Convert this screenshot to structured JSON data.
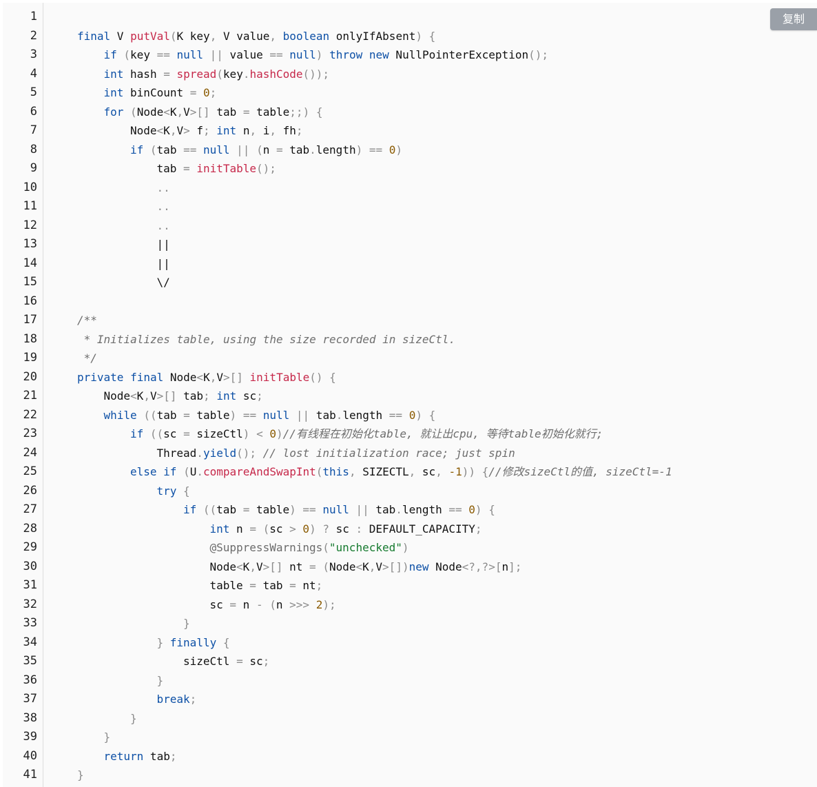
{
  "copy_button": {
    "label": "复制"
  },
  "colors": {
    "keyword": "#0d50a6",
    "function": "#c6284a",
    "number": "#8a5a00",
    "string": "#167a2f",
    "comment": "#6e6e6e",
    "operator": "#8b8b8b",
    "plain": "#111111"
  },
  "code_lines": [
    {
      "n": "1",
      "indent": 0,
      "tokens": []
    },
    {
      "n": "2",
      "indent": 1,
      "tokens": [
        [
          "kw",
          "final"
        ],
        [
          "pl",
          " V "
        ],
        [
          "fn",
          "putVal"
        ],
        [
          "op",
          "("
        ],
        [
          "pl",
          "K key"
        ],
        [
          "op",
          ","
        ],
        [
          "pl",
          " V value"
        ],
        [
          "op",
          ","
        ],
        [
          "pl",
          " "
        ],
        [
          "kw",
          "boolean"
        ],
        [
          "pl",
          " onlyIfAbsent"
        ],
        [
          "op",
          ")"
        ],
        [
          "pl",
          " "
        ],
        [
          "op",
          "{"
        ]
      ]
    },
    {
      "n": "3",
      "indent": 2,
      "tokens": [
        [
          "kw",
          "if"
        ],
        [
          "pl",
          " "
        ],
        [
          "op",
          "("
        ],
        [
          "pl",
          "key "
        ],
        [
          "op",
          "=="
        ],
        [
          "pl",
          " "
        ],
        [
          "kw",
          "null"
        ],
        [
          "pl",
          " "
        ],
        [
          "op",
          "||"
        ],
        [
          "pl",
          " value "
        ],
        [
          "op",
          "=="
        ],
        [
          "pl",
          " "
        ],
        [
          "kw",
          "null"
        ],
        [
          "op",
          ")"
        ],
        [
          "pl",
          " "
        ],
        [
          "kw",
          "throw"
        ],
        [
          "pl",
          " "
        ],
        [
          "kw",
          "new"
        ],
        [
          "pl",
          " NullPointerException"
        ],
        [
          "op",
          "();"
        ]
      ]
    },
    {
      "n": "4",
      "indent": 2,
      "tokens": [
        [
          "kw",
          "int"
        ],
        [
          "pl",
          " hash "
        ],
        [
          "op",
          "="
        ],
        [
          "pl",
          " "
        ],
        [
          "fn",
          "spread"
        ],
        [
          "op",
          "("
        ],
        [
          "pl",
          "key"
        ],
        [
          "op",
          "."
        ],
        [
          "fn",
          "hashCode"
        ],
        [
          "op",
          "());"
        ]
      ]
    },
    {
      "n": "5",
      "indent": 2,
      "tokens": [
        [
          "kw",
          "int"
        ],
        [
          "pl",
          " binCount "
        ],
        [
          "op",
          "="
        ],
        [
          "pl",
          " "
        ],
        [
          "num",
          "0"
        ],
        [
          "op",
          ";"
        ]
      ]
    },
    {
      "n": "6",
      "indent": 2,
      "tokens": [
        [
          "kw",
          "for"
        ],
        [
          "pl",
          " "
        ],
        [
          "op",
          "("
        ],
        [
          "pl",
          "Node"
        ],
        [
          "op",
          "<"
        ],
        [
          "pl",
          "K"
        ],
        [
          "op",
          ","
        ],
        [
          "pl",
          "V"
        ],
        [
          "op",
          ">[]"
        ],
        [
          "pl",
          " tab "
        ],
        [
          "op",
          "="
        ],
        [
          "pl",
          " table"
        ],
        [
          "op",
          ";;)"
        ],
        [
          "pl",
          " "
        ],
        [
          "op",
          "{"
        ]
      ]
    },
    {
      "n": "7",
      "indent": 3,
      "tokens": [
        [
          "pl",
          "Node"
        ],
        [
          "op",
          "<"
        ],
        [
          "pl",
          "K"
        ],
        [
          "op",
          ","
        ],
        [
          "pl",
          "V"
        ],
        [
          "op",
          ">"
        ],
        [
          "pl",
          " f"
        ],
        [
          "op",
          ";"
        ],
        [
          "pl",
          " "
        ],
        [
          "kw",
          "int"
        ],
        [
          "pl",
          " n"
        ],
        [
          "op",
          ","
        ],
        [
          "pl",
          " i"
        ],
        [
          "op",
          ","
        ],
        [
          "pl",
          " fh"
        ],
        [
          "op",
          ";"
        ]
      ]
    },
    {
      "n": "8",
      "indent": 3,
      "tokens": [
        [
          "kw",
          "if"
        ],
        [
          "pl",
          " "
        ],
        [
          "op",
          "("
        ],
        [
          "pl",
          "tab "
        ],
        [
          "op",
          "=="
        ],
        [
          "pl",
          " "
        ],
        [
          "kw",
          "null"
        ],
        [
          "pl",
          " "
        ],
        [
          "op",
          "||"
        ],
        [
          "pl",
          " "
        ],
        [
          "op",
          "("
        ],
        [
          "pl",
          "n "
        ],
        [
          "op",
          "="
        ],
        [
          "pl",
          " tab"
        ],
        [
          "op",
          "."
        ],
        [
          "pl",
          "length"
        ],
        [
          "op",
          ")"
        ],
        [
          "pl",
          " "
        ],
        [
          "op",
          "=="
        ],
        [
          "pl",
          " "
        ],
        [
          "num",
          "0"
        ],
        [
          "op",
          ")"
        ]
      ]
    },
    {
      "n": "9",
      "indent": 4,
      "tokens": [
        [
          "pl",
          "tab "
        ],
        [
          "op",
          "="
        ],
        [
          "pl",
          " "
        ],
        [
          "fn",
          "initTable"
        ],
        [
          "op",
          "();"
        ]
      ]
    },
    {
      "n": "10",
      "indent": 4,
      "tokens": [
        [
          "op",
          ".."
        ]
      ]
    },
    {
      "n": "11",
      "indent": 4,
      "tokens": [
        [
          "op",
          ".."
        ]
      ]
    },
    {
      "n": "12",
      "indent": 4,
      "tokens": [
        [
          "op",
          ".."
        ]
      ]
    },
    {
      "n": "13",
      "indent": 4,
      "tokens": [
        [
          "pl",
          "||"
        ]
      ]
    },
    {
      "n": "14",
      "indent": 4,
      "tokens": [
        [
          "pl",
          "||"
        ]
      ]
    },
    {
      "n": "15",
      "indent": 4,
      "tokens": [
        [
          "pl",
          "\\/"
        ]
      ]
    },
    {
      "n": "16",
      "indent": 0,
      "tokens": []
    },
    {
      "n": "17",
      "indent": 1,
      "tokens": [
        [
          "cm",
          "/**"
        ]
      ]
    },
    {
      "n": "18",
      "indent": 1,
      "tokens": [
        [
          "cm",
          " * Initializes table, using the size recorded in sizeCtl."
        ]
      ]
    },
    {
      "n": "19",
      "indent": 1,
      "tokens": [
        [
          "cm",
          " */"
        ]
      ]
    },
    {
      "n": "20",
      "indent": 1,
      "tokens": [
        [
          "kw",
          "private"
        ],
        [
          "pl",
          " "
        ],
        [
          "kw",
          "final"
        ],
        [
          "pl",
          " Node"
        ],
        [
          "op",
          "<"
        ],
        [
          "pl",
          "K"
        ],
        [
          "op",
          ","
        ],
        [
          "pl",
          "V"
        ],
        [
          "op",
          ">[]"
        ],
        [
          "pl",
          " "
        ],
        [
          "fn",
          "initTable"
        ],
        [
          "op",
          "()"
        ],
        [
          "pl",
          " "
        ],
        [
          "op",
          "{"
        ]
      ]
    },
    {
      "n": "21",
      "indent": 2,
      "tokens": [
        [
          "pl",
          "Node"
        ],
        [
          "op",
          "<"
        ],
        [
          "pl",
          "K"
        ],
        [
          "op",
          ","
        ],
        [
          "pl",
          "V"
        ],
        [
          "op",
          ">[]"
        ],
        [
          "pl",
          " tab"
        ],
        [
          "op",
          ";"
        ],
        [
          "pl",
          " "
        ],
        [
          "kw",
          "int"
        ],
        [
          "pl",
          " sc"
        ],
        [
          "op",
          ";"
        ]
      ]
    },
    {
      "n": "22",
      "indent": 2,
      "tokens": [
        [
          "kw",
          "while"
        ],
        [
          "pl",
          " "
        ],
        [
          "op",
          "(("
        ],
        [
          "pl",
          "tab "
        ],
        [
          "op",
          "="
        ],
        [
          "pl",
          " table"
        ],
        [
          "op",
          ")"
        ],
        [
          "pl",
          " "
        ],
        [
          "op",
          "=="
        ],
        [
          "pl",
          " "
        ],
        [
          "kw",
          "null"
        ],
        [
          "pl",
          " "
        ],
        [
          "op",
          "||"
        ],
        [
          "pl",
          " tab"
        ],
        [
          "op",
          "."
        ],
        [
          "pl",
          "length "
        ],
        [
          "op",
          "=="
        ],
        [
          "pl",
          " "
        ],
        [
          "num",
          "0"
        ],
        [
          "op",
          ")"
        ],
        [
          "pl",
          " "
        ],
        [
          "op",
          "{"
        ]
      ]
    },
    {
      "n": "23",
      "indent": 3,
      "tokens": [
        [
          "kw",
          "if"
        ],
        [
          "pl",
          " "
        ],
        [
          "op",
          "(("
        ],
        [
          "pl",
          "sc "
        ],
        [
          "op",
          "="
        ],
        [
          "pl",
          " sizeCtl"
        ],
        [
          "op",
          ")"
        ],
        [
          "pl",
          " "
        ],
        [
          "op",
          "<"
        ],
        [
          "pl",
          " "
        ],
        [
          "num",
          "0"
        ],
        [
          "op",
          ")"
        ],
        [
          "cm",
          "//有线程在初始化table, 就让出cpu, 等待table初始化就行;"
        ]
      ]
    },
    {
      "n": "24",
      "indent": 4,
      "tokens": [
        [
          "pl",
          "Thread"
        ],
        [
          "op",
          "."
        ],
        [
          "kw",
          "yield"
        ],
        [
          "op",
          "();"
        ],
        [
          "pl",
          " "
        ],
        [
          "cm",
          "// lost initialization race; just spin"
        ]
      ]
    },
    {
      "n": "25",
      "indent": 3,
      "tokens": [
        [
          "kw",
          "else"
        ],
        [
          "pl",
          " "
        ],
        [
          "kw",
          "if"
        ],
        [
          "pl",
          " "
        ],
        [
          "op",
          "("
        ],
        [
          "pl",
          "U"
        ],
        [
          "op",
          "."
        ],
        [
          "fn",
          "compareAndSwapInt"
        ],
        [
          "op",
          "("
        ],
        [
          "kw",
          "this"
        ],
        [
          "op",
          ","
        ],
        [
          "pl",
          " SIZECTL"
        ],
        [
          "op",
          ","
        ],
        [
          "pl",
          " sc"
        ],
        [
          "op",
          ","
        ],
        [
          "pl",
          " "
        ],
        [
          "num",
          "-1"
        ],
        [
          "op",
          "))"
        ],
        [
          "pl",
          " "
        ],
        [
          "op",
          "{"
        ],
        [
          "cm",
          "//修改sizeCtl的值, sizeCtl=-1"
        ]
      ]
    },
    {
      "n": "26",
      "indent": 4,
      "tokens": [
        [
          "kw",
          "try"
        ],
        [
          "pl",
          " "
        ],
        [
          "op",
          "{"
        ]
      ]
    },
    {
      "n": "27",
      "indent": 5,
      "tokens": [
        [
          "kw",
          "if"
        ],
        [
          "pl",
          " "
        ],
        [
          "op",
          "(("
        ],
        [
          "pl",
          "tab "
        ],
        [
          "op",
          "="
        ],
        [
          "pl",
          " table"
        ],
        [
          "op",
          ")"
        ],
        [
          "pl",
          " "
        ],
        [
          "op",
          "=="
        ],
        [
          "pl",
          " "
        ],
        [
          "kw",
          "null"
        ],
        [
          "pl",
          " "
        ],
        [
          "op",
          "||"
        ],
        [
          "pl",
          " tab"
        ],
        [
          "op",
          "."
        ],
        [
          "pl",
          "length "
        ],
        [
          "op",
          "=="
        ],
        [
          "pl",
          " "
        ],
        [
          "num",
          "0"
        ],
        [
          "op",
          ")"
        ],
        [
          "pl",
          " "
        ],
        [
          "op",
          "{"
        ]
      ]
    },
    {
      "n": "28",
      "indent": 6,
      "tokens": [
        [
          "kw",
          "int"
        ],
        [
          "pl",
          " n "
        ],
        [
          "op",
          "="
        ],
        [
          "pl",
          " "
        ],
        [
          "op",
          "("
        ],
        [
          "pl",
          "sc "
        ],
        [
          "op",
          ">"
        ],
        [
          "pl",
          " "
        ],
        [
          "num",
          "0"
        ],
        [
          "op",
          ")"
        ],
        [
          "pl",
          " "
        ],
        [
          "op",
          "?"
        ],
        [
          "pl",
          " sc "
        ],
        [
          "op",
          ":"
        ],
        [
          "pl",
          " DEFAULT_CAPACITY"
        ],
        [
          "op",
          ";"
        ]
      ]
    },
    {
      "n": "29",
      "indent": 6,
      "tokens": [
        [
          "an",
          "@SuppressWarnings"
        ],
        [
          "op",
          "("
        ],
        [
          "str",
          "\"unchecked\""
        ],
        [
          "op",
          ")"
        ]
      ]
    },
    {
      "n": "30",
      "indent": 6,
      "tokens": [
        [
          "pl",
          "Node"
        ],
        [
          "op",
          "<"
        ],
        [
          "pl",
          "K"
        ],
        [
          "op",
          ","
        ],
        [
          "pl",
          "V"
        ],
        [
          "op",
          ">[]"
        ],
        [
          "pl",
          " nt "
        ],
        [
          "op",
          "="
        ],
        [
          "pl",
          " "
        ],
        [
          "op",
          "("
        ],
        [
          "pl",
          "Node"
        ],
        [
          "op",
          "<"
        ],
        [
          "pl",
          "K"
        ],
        [
          "op",
          ","
        ],
        [
          "pl",
          "V"
        ],
        [
          "op",
          ">[])"
        ],
        [
          "kw",
          "new"
        ],
        [
          "pl",
          " Node"
        ],
        [
          "op",
          "<?,?>["
        ],
        [
          "pl",
          "n"
        ],
        [
          "op",
          "];"
        ]
      ]
    },
    {
      "n": "31",
      "indent": 6,
      "tokens": [
        [
          "pl",
          "table "
        ],
        [
          "op",
          "="
        ],
        [
          "pl",
          " tab "
        ],
        [
          "op",
          "="
        ],
        [
          "pl",
          " nt"
        ],
        [
          "op",
          ";"
        ]
      ]
    },
    {
      "n": "32",
      "indent": 6,
      "tokens": [
        [
          "pl",
          "sc "
        ],
        [
          "op",
          "="
        ],
        [
          "pl",
          " n "
        ],
        [
          "op",
          "-"
        ],
        [
          "pl",
          " "
        ],
        [
          "op",
          "("
        ],
        [
          "pl",
          "n "
        ],
        [
          "op",
          ">>>"
        ],
        [
          "pl",
          " "
        ],
        [
          "num",
          "2"
        ],
        [
          "op",
          ");"
        ]
      ]
    },
    {
      "n": "33",
      "indent": 5,
      "tokens": [
        [
          "op",
          "}"
        ]
      ]
    },
    {
      "n": "34",
      "indent": 4,
      "tokens": [
        [
          "op",
          "}"
        ],
        [
          "pl",
          " "
        ],
        [
          "kw",
          "finally"
        ],
        [
          "pl",
          " "
        ],
        [
          "op",
          "{"
        ]
      ]
    },
    {
      "n": "35",
      "indent": 5,
      "tokens": [
        [
          "pl",
          "sizeCtl "
        ],
        [
          "op",
          "="
        ],
        [
          "pl",
          " sc"
        ],
        [
          "op",
          ";"
        ]
      ]
    },
    {
      "n": "36",
      "indent": 4,
      "tokens": [
        [
          "op",
          "}"
        ]
      ]
    },
    {
      "n": "37",
      "indent": 4,
      "tokens": [
        [
          "kw",
          "break"
        ],
        [
          "op",
          ";"
        ]
      ]
    },
    {
      "n": "38",
      "indent": 3,
      "tokens": [
        [
          "op",
          "}"
        ]
      ]
    },
    {
      "n": "39",
      "indent": 2,
      "tokens": [
        [
          "op",
          "}"
        ]
      ]
    },
    {
      "n": "40",
      "indent": 2,
      "tokens": [
        [
          "kw",
          "return"
        ],
        [
          "pl",
          " tab"
        ],
        [
          "op",
          ";"
        ]
      ]
    },
    {
      "n": "41",
      "indent": 1,
      "tokens": [
        [
          "op",
          "}"
        ]
      ]
    }
  ]
}
